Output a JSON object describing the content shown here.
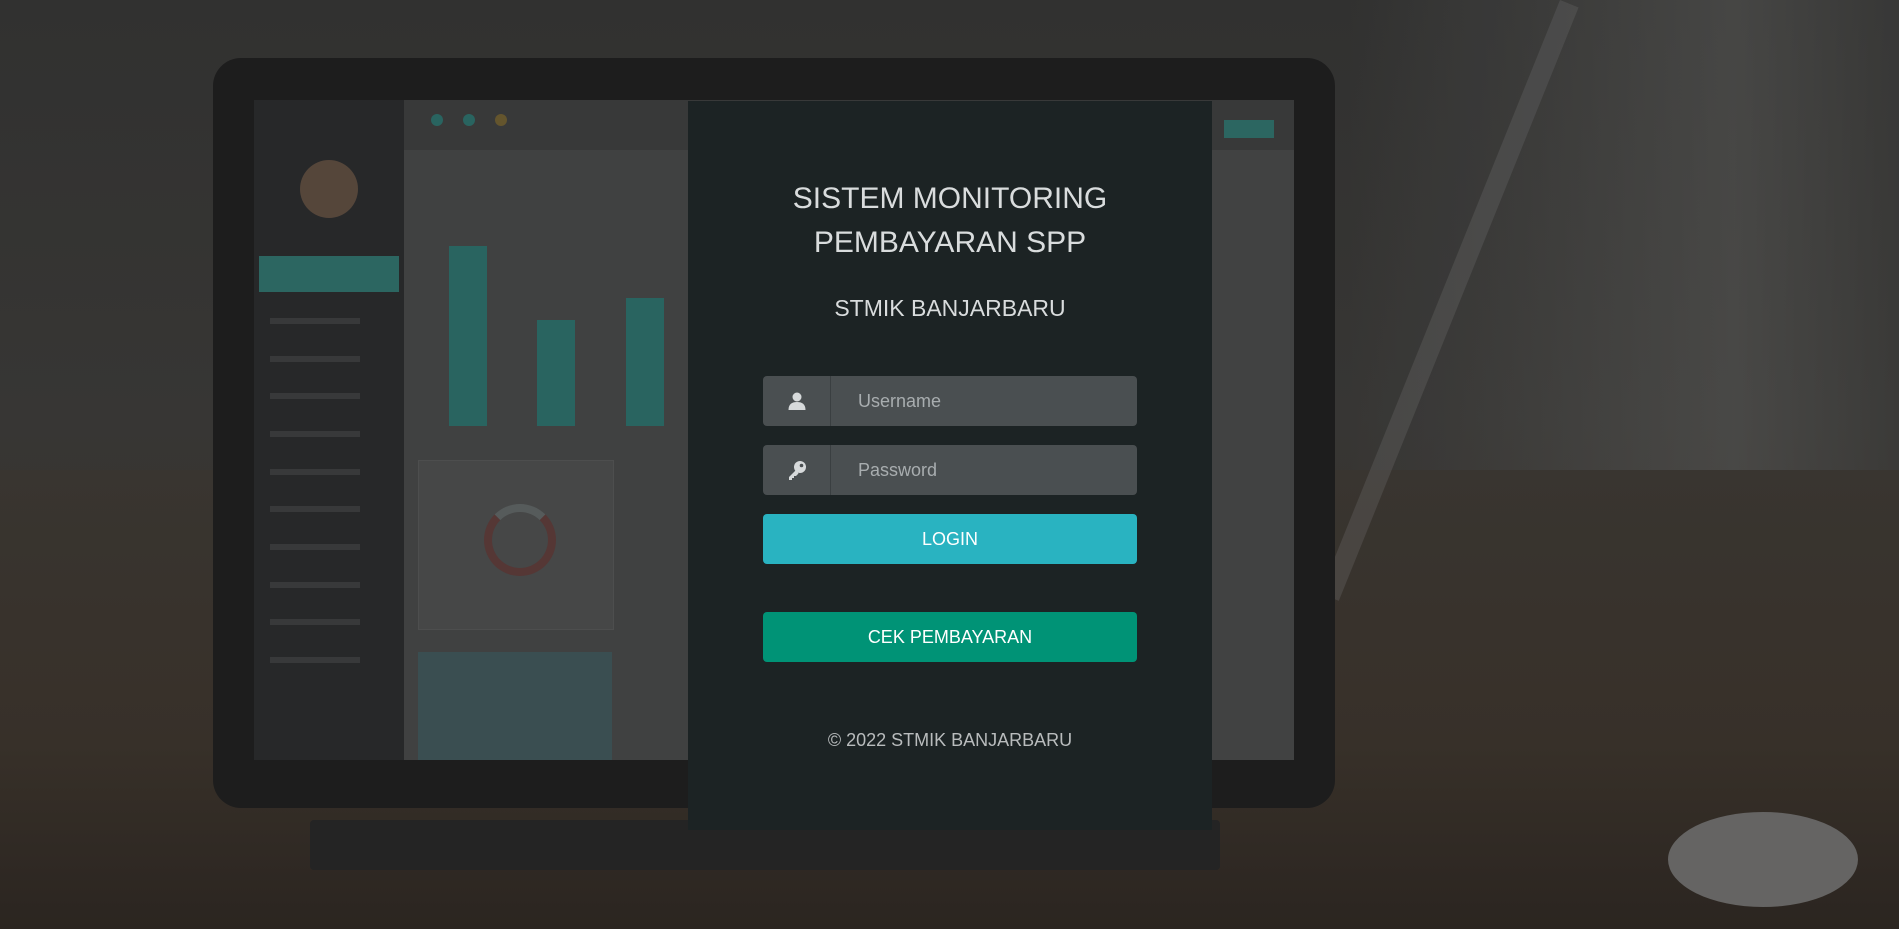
{
  "login": {
    "title_line1": "SISTEM MONITORING",
    "title_line2": "PEMBAYARAN SPP",
    "subtitle": "STMIK BANJARBARU",
    "username_placeholder": "Username",
    "password_placeholder": "Password",
    "login_label": "LOGIN",
    "cek_label": "CEK PEMBAYARAN",
    "footer": "© 2022 STMIK BANJARBARU"
  },
  "icons": {
    "username": "user-icon",
    "password": "key-icon"
  },
  "colors": {
    "panel_bg": "#1c2324",
    "login_button": "#29b3c1",
    "cek_button": "#009376",
    "input_bg": "#4a4f51"
  }
}
